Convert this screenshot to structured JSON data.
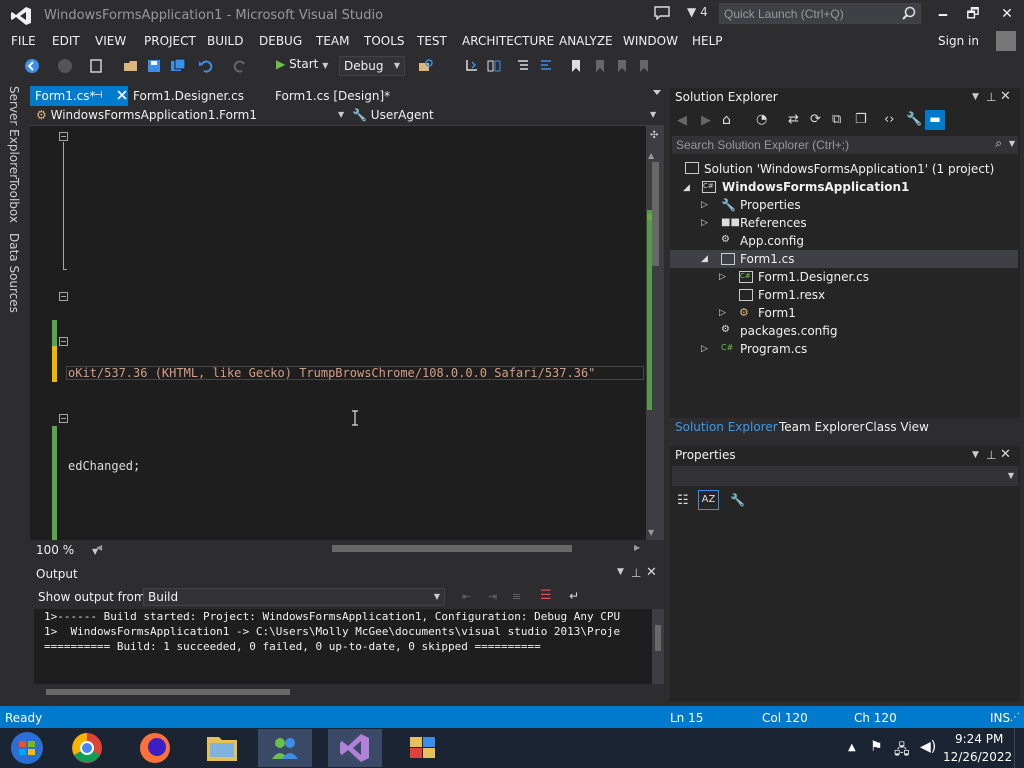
{
  "window": {
    "title": "WindowsFormsApplication1 - Microsoft Visual Studio",
    "notification_count": "4",
    "quick_launch_placeholder": "Quick Launch (Ctrl+Q)",
    "min_glyph": "🗕",
    "restore_glyph": "🗗",
    "close_glyph": "✕"
  },
  "menu": {
    "items": [
      "FILE",
      "EDIT",
      "VIEW",
      "PROJECT",
      "BUILD",
      "DEBUG",
      "TEAM",
      "TOOLS",
      "TEST",
      "ARCHITECTURE",
      "ANALYZE",
      "WINDOW",
      "HELP"
    ],
    "sign_in": "Sign in"
  },
  "toolbar": {
    "start_label": "Start",
    "config": "Debug"
  },
  "left_tabs": [
    "Server Explorer",
    "Toolbox",
    "Data Sources"
  ],
  "doc_tabs": {
    "active": "Form1.cs*",
    "second": "Form1.Designer.cs",
    "third": "Form1.cs [Design]*"
  },
  "navbar": {
    "type": "WindowsFormsApplication1.Form1",
    "member": "UserAgent"
  },
  "editor": {
    "line_current": "oKit/537.36 (KHTML, like Gecko) TrumpBrowsChrome/108.0.0.0 Safari/537.36\"",
    "line_other": "edChanged;",
    "zoom": "100 %"
  },
  "output": {
    "title": "Output",
    "show_from_label": "Show output from:",
    "source": "Build",
    "lines": [
      "1>------ Build started: Project: WindowsFormsApplication1, Configuration: Debug Any CPU",
      "1>  WindowsFormsApplication1 -> C:\\Users\\Molly McGee\\documents\\visual studio 2013\\Proje",
      "========== Build: 1 succeeded, 0 failed, 0 up-to-date, 0 skipped =========="
    ]
  },
  "solution_explorer": {
    "title": "Solution Explorer",
    "search_placeholder": "Search Solution Explorer (Ctrl+;)",
    "items": [
      {
        "label": "Solution 'WindowsFormsApplication1' (1 project)",
        "icon": "solution-icon"
      },
      {
        "label": "WindowsFormsApplication1",
        "icon": "csharp-project-icon"
      },
      {
        "label": "Properties",
        "icon": "wrench-icon"
      },
      {
        "label": "References",
        "icon": "references-icon"
      },
      {
        "label": "App.config",
        "icon": "config-file-icon"
      },
      {
        "label": "Form1.cs",
        "icon": "form-icon"
      },
      {
        "label": "Form1.Designer.cs",
        "icon": "csharp-file-icon"
      },
      {
        "label": "Form1.resx",
        "icon": "resx-file-icon"
      },
      {
        "label": "Form1",
        "icon": "class-icon"
      },
      {
        "label": "packages.config",
        "icon": "config-file-icon"
      },
      {
        "label": "Program.cs",
        "icon": "csharp-file-icon"
      }
    ],
    "bottom_tabs": [
      "Solution Explorer",
      "Team Explorer",
      "Class View"
    ]
  },
  "properties": {
    "title": "Properties"
  },
  "status": {
    "ready": "Ready",
    "ln": "Ln 15",
    "col": "Col 120",
    "ch": "Ch 120",
    "ins": "INS"
  },
  "taskbar": {
    "time": "9:24 PM",
    "date": "12/26/2022"
  },
  "colors": {
    "accent": "#007acc",
    "background": "#2d2d30",
    "editor": "#1e1e1e",
    "string": "#d69d85"
  }
}
